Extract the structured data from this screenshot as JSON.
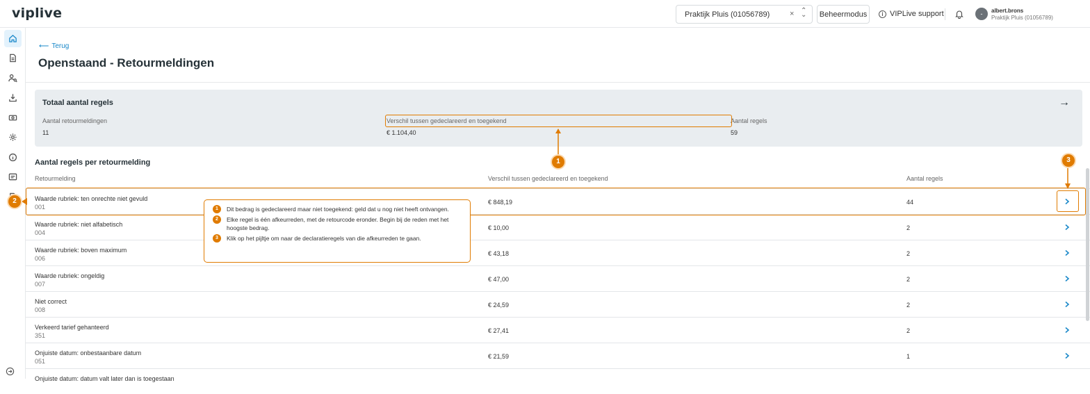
{
  "app": {
    "logo": "viplive"
  },
  "topbar": {
    "practice_value": "Praktijk Pluis (01056789)",
    "clear_glyph": "×",
    "beheer_label": "Beheermodus",
    "support_label": "VIPLive support",
    "avatar_initial": "-",
    "user_name": "albert.brons",
    "user_practice": "Praktijk Pluis (01056789)"
  },
  "sidebar": {
    "items": [
      {
        "icon": "home-icon",
        "active": true
      },
      {
        "icon": "document-icon"
      },
      {
        "icon": "patient-search-icon"
      },
      {
        "icon": "download-icon"
      },
      {
        "icon": "money-icon"
      },
      {
        "icon": "settings-icon"
      },
      {
        "icon": "info-icon"
      },
      {
        "icon": "message-icon"
      },
      {
        "icon": "invoice-icon"
      }
    ]
  },
  "page": {
    "back_label": "Terug",
    "title": "Openstaand - Retourmeldingen"
  },
  "summary": {
    "title": "Totaal aantal regels",
    "stats": [
      {
        "label": "Aantal retourmeldingen",
        "value": "11"
      },
      {
        "label": "Verschil tussen gedeclareerd en toegekend",
        "value": "€ 1.104,40"
      },
      {
        "label": "Aantal regels",
        "value": "59"
      }
    ]
  },
  "table": {
    "title": "Aantal regels per retourmelding",
    "headers": [
      "Retourmelding",
      "Verschil tussen gedeclareerd en toegekend",
      "Aantal regels"
    ],
    "rows": [
      {
        "name": "Waarde rubriek: ten onrechte niet gevuld",
        "code": "001",
        "amount": "€ 848,19",
        "count": "44"
      },
      {
        "name": "Waarde rubriek: niet alfabetisch",
        "code": "004",
        "amount": "€ 10,00",
        "count": "2"
      },
      {
        "name": "Waarde rubriek: boven maximum",
        "code": "006",
        "amount": "€ 43,18",
        "count": "2"
      },
      {
        "name": "Waarde rubriek: ongeldig",
        "code": "007",
        "amount": "€ 47,00",
        "count": "2"
      },
      {
        "name": "Niet correct",
        "code": "008",
        "amount": "€ 24,59",
        "count": "2"
      },
      {
        "name": "Verkeerd tarief gehanteerd",
        "code": "351",
        "amount": "€ 27,41",
        "count": "2"
      },
      {
        "name": "Onjuiste datum: onbestaanbare datum",
        "code": "051",
        "amount": "€ 21,59",
        "count": "1"
      },
      {
        "name": "Onjuiste datum: datum valt later dan is toegestaan",
        "code": "",
        "amount": "",
        "count": ""
      }
    ]
  },
  "annotations": {
    "badges": [
      "1",
      "2",
      "3"
    ],
    "accent_color": "#e07b00",
    "tips": [
      {
        "num": "1",
        "text": "Dit bedrag is gedeclareerd maar niet toegekend: geld dat u nog niet heeft ontvangen."
      },
      {
        "num": "2",
        "text": "Elke regel is één afkeurreden, met de retourcode eronder. Begin bij de reden met het hoogste bedrag."
      },
      {
        "num": "3",
        "text": "Klik op het pijltje om naar de declaratieregels van die afkeurreden te gaan."
      }
    ]
  }
}
